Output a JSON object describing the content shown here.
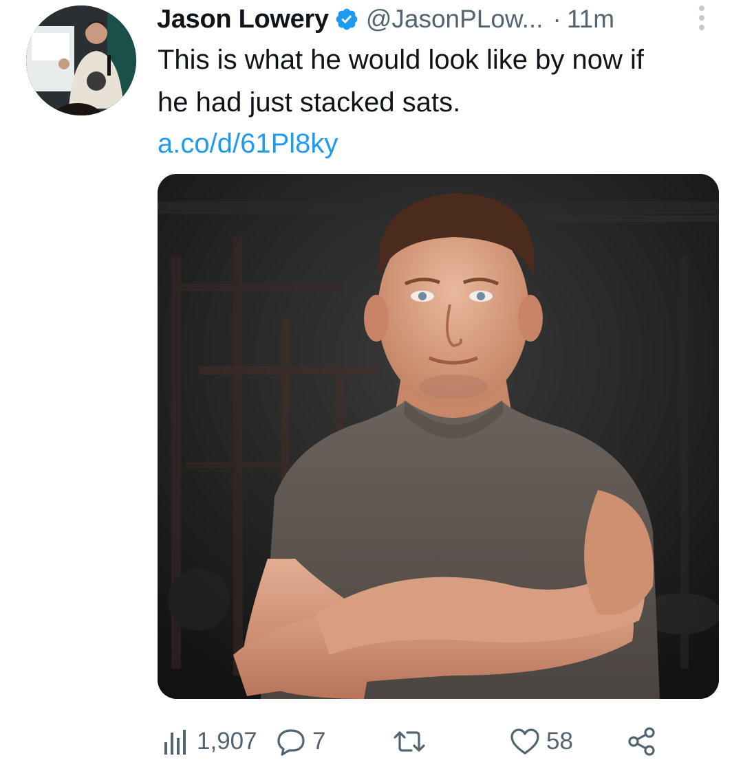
{
  "tweet": {
    "author_name": "Jason Lowery",
    "handle": "@JasonPLow...",
    "separator": "·",
    "time": "11m",
    "text": "This is what he would look like by now if\nhe had just stacked sats.",
    "link": "a.co/d/61Pl8ky"
  },
  "actions": {
    "views": "1,907",
    "replies": "7",
    "retweets": "",
    "likes": "58"
  },
  "icons": {
    "verified": "verified-badge-icon",
    "more": "more-vertical-icon",
    "views": "analytics-icon",
    "reply": "reply-icon",
    "retweet": "retweet-icon",
    "like": "heart-icon",
    "share": "share-icon"
  },
  "colors": {
    "accent": "#1d9bf0",
    "text": "#0f1419",
    "secondary": "#536471"
  }
}
